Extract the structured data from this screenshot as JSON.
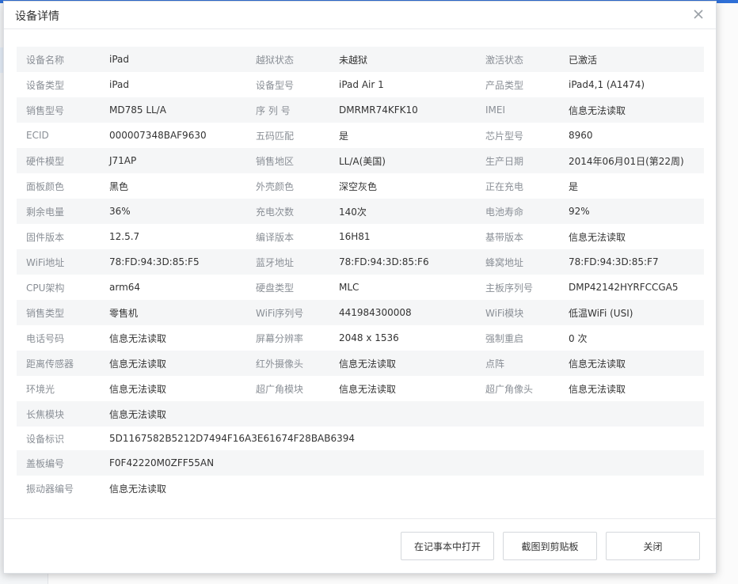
{
  "dialog": {
    "title": "设备详情",
    "close_icon": "close-icon"
  },
  "rows3": [
    [
      [
        "设备名称",
        "iPad"
      ],
      [
        "越狱状态",
        "未越狱"
      ],
      [
        "激活状态",
        "已激活"
      ]
    ],
    [
      [
        "设备类型",
        "iPad"
      ],
      [
        "设备型号",
        "iPad Air 1"
      ],
      [
        "产品类型",
        "iPad4,1 (A1474)"
      ]
    ],
    [
      [
        "销售型号",
        "MD785 LL/A"
      ],
      [
        "序 列 号",
        "DMRMR74KFK10"
      ],
      [
        "IMEI",
        "信息无法读取"
      ]
    ],
    [
      [
        "ECID",
        "000007348BAF9630"
      ],
      [
        "五码匹配",
        "是"
      ],
      [
        "芯片型号",
        "8960"
      ]
    ],
    [
      [
        "硬件模型",
        "J71AP"
      ],
      [
        "销售地区",
        "LL/A(美国)"
      ],
      [
        "生产日期",
        "2014年06月01日(第22周)"
      ]
    ],
    [
      [
        "面板颜色",
        "黑色"
      ],
      [
        "外壳颜色",
        "深空灰色"
      ],
      [
        "正在充电",
        "是"
      ]
    ],
    [
      [
        "剩余电量",
        "36%"
      ],
      [
        "充电次数",
        "140次"
      ],
      [
        "电池寿命",
        "92%"
      ]
    ],
    [
      [
        "固件版本",
        "12.5.7"
      ],
      [
        "编译版本",
        "16H81"
      ],
      [
        "基带版本",
        "信息无法读取"
      ]
    ],
    [
      [
        "WiFi地址",
        "78:FD:94:3D:85:F5"
      ],
      [
        "蓝牙地址",
        "78:FD:94:3D:85:F6"
      ],
      [
        "蜂窝地址",
        "78:FD:94:3D:85:F7"
      ]
    ],
    [
      [
        "CPU架构",
        "arm64"
      ],
      [
        "硬盘类型",
        "MLC"
      ],
      [
        "主板序列号",
        "DMP42142HYRFCCGA5"
      ]
    ],
    [
      [
        "销售类型",
        "零售机"
      ],
      [
        "WiFi序列号",
        "441984300008"
      ],
      [
        "WiFi模块",
        "低温WiFi (USI)"
      ]
    ],
    [
      [
        "电话号码",
        "信息无法读取"
      ],
      [
        "屏幕分辨率",
        "2048 x 1536"
      ],
      [
        "强制重启",
        "0 次"
      ]
    ],
    [
      [
        "距离传感器",
        "信息无法读取"
      ],
      [
        "红外摄像头",
        "信息无法读取"
      ],
      [
        "点阵",
        "信息无法读取"
      ]
    ],
    [
      [
        "环境光",
        "信息无法读取"
      ],
      [
        "超广角模块",
        "信息无法读取"
      ],
      [
        "超广角像头",
        "信息无法读取"
      ]
    ]
  ],
  "rows1": [
    [
      "长焦模块",
      "信息无法读取"
    ],
    [
      "设备标识",
      "5D1167582B5212D7494F16A3E61674F28BAB6394"
    ],
    [
      "盖板编号",
      "F0F42220M0ZFF55AN"
    ],
    [
      "振动器编号",
      "信息无法读取"
    ]
  ],
  "buttons": {
    "notepad": "在记事本中打开",
    "screenshot": "截图到剪贴板",
    "close": "关闭"
  }
}
